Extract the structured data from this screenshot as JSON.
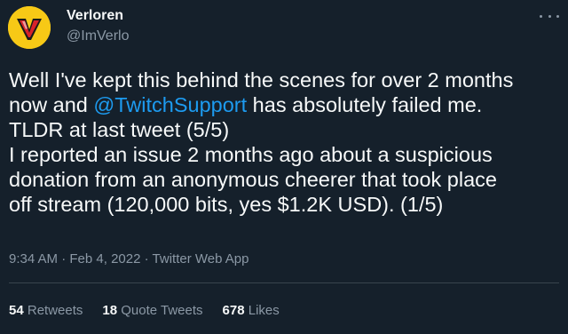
{
  "author": {
    "display_name": "Verloren",
    "handle": "@ImVerlo"
  },
  "tweet": {
    "line1": "Well I've kept this behind the scenes for over 2 months",
    "line2_prefix": "now and ",
    "mention": "@TwitchSupport",
    "line2_suffix": " has absolutely failed me.",
    "line3": "TLDR at last tweet (5/5)",
    "line4": "I reported an issue 2 months ago about a suspicious",
    "line5": "donation from an anonymous cheerer that took place",
    "line6": "off stream (120,000 bits, yes $1.2K USD). (1/5)"
  },
  "meta": {
    "time": "9:34 AM",
    "date": "Feb 4, 2022",
    "source": "Twitter Web App",
    "separator": "·"
  },
  "stats": {
    "retweets_count": "54",
    "retweets_label": "Retweets",
    "quotes_count": "18",
    "quotes_label": "Quote Tweets",
    "likes_count": "678",
    "likes_label": "Likes"
  },
  "colors": {
    "background": "#15202b",
    "text": "#f7f9f9",
    "muted": "#8b98a5",
    "link": "#1d9bf0",
    "avatar_bg": "#f7c916",
    "avatar_logo": "#d8232a"
  },
  "icons": {
    "more": "more-horizontal-icon"
  }
}
